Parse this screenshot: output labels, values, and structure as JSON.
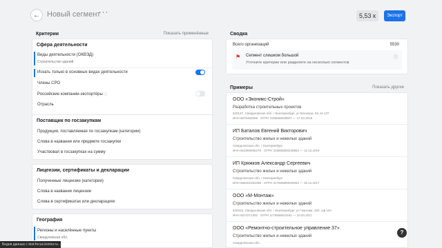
{
  "header": {
    "back_icon": "arrow-left-icon",
    "title": "Новый сегмент",
    "more": "···",
    "count": "5,53 к",
    "export_label": "Экспорт"
  },
  "criteria": {
    "title": "Критерии",
    "show_applied": "Показать применённые",
    "activity": {
      "title": "Сфера деятельности",
      "okved_label": "Виды деятельности (ОКВЭД)",
      "okved_value": "Строительство зданий",
      "main_only_label": "Искать только в основных видах деятельности",
      "main_only_on": true,
      "sro_label": "Члены СРО",
      "exporters_label": "Российские компании-экспортёры",
      "exporters_on": false,
      "industry_label": "Отрасль"
    },
    "supplier": {
      "title": "Поставщик по госзакупкам",
      "products_label": "Продукция, поставляемая по госзакупкам (категории)",
      "words_label": "Слова в названии или предмете госзакупки",
      "sum_label": "Участвовал в госзакупках на сумму"
    },
    "licenses": {
      "title": "Лицензии, сертификаты и декларации",
      "received_label": "Полученные лицензии (категории)",
      "words_label": "Слова в названии лицензии",
      "cert_label": "Слова в сертификатах или декларациях"
    },
    "geo": {
      "title": "География",
      "regions_label": "Регионы и населённые пункты",
      "regions_value": "Свердловская обл."
    }
  },
  "summary": {
    "title": "Сводка",
    "all_orgs_label": "Всего организаций",
    "all_orgs_value": "5530",
    "warning_title": "Сегмент слишком большой",
    "warning_text": "Уточните критерии или разделите на несколько сегментов",
    "flag_icon": "flag-icon",
    "info_icon": "info-icon"
  },
  "examples": {
    "title": "Примеры",
    "show_other": "Показать другие",
    "items": [
      {
        "name": "ООО «Эконикс-Строй»",
        "category": "Разработка строительных проектов",
        "address": "620137, Свердловская обл. г Екатеринбург, ул Блюхера, 63, кв 137",
        "ids": "ИНН 6670482008 · ОГРН 1196658028907 — 17.04.2019"
      },
      {
        "name": "ИП Баталов Евгений Викторович",
        "category": "Строительство жилых и нежилых зданий",
        "address": "Свердловская обл. г Екатеринбург",
        "ids": "ИНН 661906005278 · ОГРН 319665800249554 — 12.12.2019"
      },
      {
        "name": "ИП Кряжков Александр Сергеевич",
        "category": "Строительство жилых и нежилых зданий",
        "address": "Свердловская обл. г Екатеринбург",
        "ids": "ИНН 666202181069 · ОГРН 317665800025064 — 25.12.2017"
      },
      {
        "name": "ООО «М-Монтаж»",
        "category": "Строительство жилых и нежилых зданий",
        "address": "620016, Свердловская обл. г Екатеринбург, ул Чкалова, 250, оф 10А",
        "ids": "ИНН 6671071392 · ОГРН 1176658023182 — 10.04.2017"
      },
      {
        "name": "ООО «Ремонтно-строительное управление 37»",
        "category": "Строительство жилых и нежилых зданий",
        "address": "Свердловская обл.",
        "ids": ""
      }
    ]
  },
  "help_label": "?",
  "status_strip": "Бедня данных с test-focus.kontur.ru..."
}
